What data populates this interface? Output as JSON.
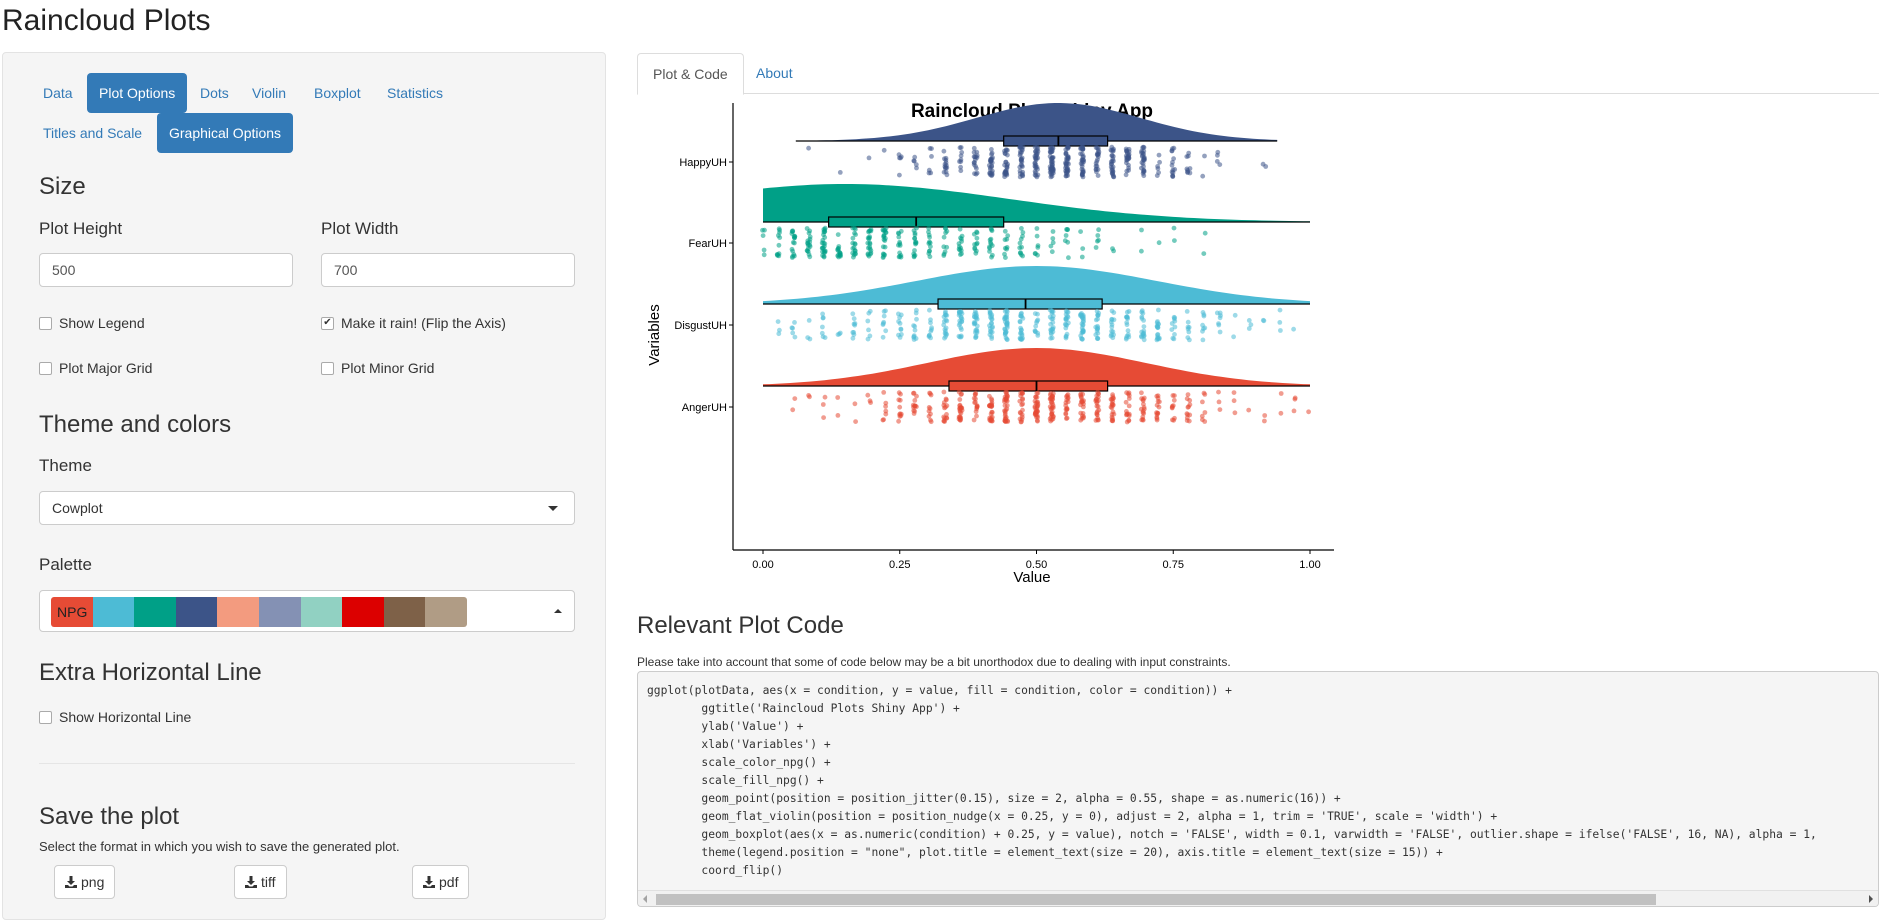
{
  "app": {
    "title": "Raincloud Plots"
  },
  "sidebar": {
    "pills_row1": [
      {
        "label": "Data",
        "active": false
      },
      {
        "label": "Plot Options",
        "active": true
      },
      {
        "label": "Dots",
        "active": false
      },
      {
        "label": "Violin",
        "active": false
      },
      {
        "label": "Boxplot",
        "active": false
      },
      {
        "label": "Statistics",
        "active": false
      }
    ],
    "pills_row2": [
      {
        "label": "Titles and Scale",
        "active": false
      },
      {
        "label": "Graphical Options",
        "active": true
      }
    ],
    "size": {
      "heading": "Size",
      "plot_height_label": "Plot Height",
      "plot_height_value": "500",
      "plot_width_label": "Plot Width",
      "plot_width_value": "700"
    },
    "checkboxes": {
      "show_legend": {
        "label": "Show Legend",
        "checked": false
      },
      "make_it_rain": {
        "label": "Make it rain! (Flip the Axis)",
        "checked": true
      },
      "major_grid": {
        "label": "Plot Major Grid",
        "checked": false
      },
      "minor_grid": {
        "label": "Plot Minor Grid",
        "checked": false
      }
    },
    "theme_colors": {
      "heading": "Theme and colors",
      "theme_label": "Theme",
      "theme_value": "Cowplot",
      "palette_label": "Palette",
      "palette_name": "NPG",
      "palette_colors": [
        "#E64B35",
        "#4DBBD5",
        "#00A087",
        "#3C5488",
        "#F39B7F",
        "#8491B4",
        "#91D1C2",
        "#DC0000",
        "#7E6148",
        "#B09C85"
      ]
    },
    "extra_line": {
      "heading": "Extra Horizontal Line",
      "show_label": "Show Horizontal Line",
      "checked": false
    },
    "save": {
      "heading": "Save the plot",
      "help": "Select the format in which you wish to save the generated plot.",
      "buttons": [
        "png",
        "tiff",
        "pdf"
      ]
    }
  },
  "main": {
    "tabs": [
      {
        "label": "Plot & Code",
        "active": true
      },
      {
        "label": "About",
        "active": false
      }
    ],
    "code_heading": "Relevant Plot Code",
    "code_note": "Please take into account that some of code below may be a bit unorthodox due to dealing with input constraints.",
    "code_lines": [
      "ggplot(plotData, aes(x = condition, y = value, fill = condition, color = condition)) +",
      "        ggtitle('Raincloud Plots Shiny App') +",
      "        ylab('Value') +",
      "        xlab('Variables') +",
      "        scale_color_npg() +",
      "        scale_fill_npg() +",
      "        geom_point(position = position_jitter(0.15), size = 2, alpha = 0.55, shape = as.numeric(16)) +",
      "        geom_flat_violin(position = position_nudge(x = 0.25, y = 0), adjust = 2, alpha = 1, trim = 'TRUE', scale = 'width') +",
      "        geom_boxplot(aes(x = as.numeric(condition) + 0.25, y = value), notch = 'FALSE', width = 0.1, varwidth = 'FALSE', outlier.shape = ifelse('FALSE', 16, NA), alpha = 1,",
      "        theme(legend.position = \"none\", plot.title = element_text(size = 20), axis.title = element_text(size = 15)) +",
      "        coord_flip()"
    ]
  },
  "chart_data": {
    "type": "raincloud",
    "title": "Raincloud Plots Shiny App",
    "xlabel": "Value",
    "ylabel": "Variables",
    "xlim": [
      0,
      1
    ],
    "x_ticks": [
      "0.00",
      "0.25",
      "0.50",
      "0.75",
      "1.00"
    ],
    "grid": false,
    "legend": "none",
    "series": [
      {
        "name": "HappyUH",
        "color": "#3C5488",
        "min": 0.06,
        "q1": 0.44,
        "median": 0.54,
        "q3": 0.63,
        "max": 0.94,
        "density_mode": 0.54,
        "density_spread": 0.15
      },
      {
        "name": "FearUH",
        "color": "#00A087",
        "min": 0.0,
        "q1": 0.12,
        "median": 0.28,
        "q3": 0.44,
        "max": 1.0,
        "density_mode": 0.15,
        "density_spread": 0.3
      },
      {
        "name": "DisgustUH",
        "color": "#4DBBD5",
        "min": 0.0,
        "q1": 0.32,
        "median": 0.48,
        "q3": 0.62,
        "max": 1.0,
        "density_mode": 0.5,
        "density_spread": 0.22
      },
      {
        "name": "AngerUH",
        "color": "#E64B35",
        "min": 0.0,
        "q1": 0.34,
        "median": 0.5,
        "q3": 0.63,
        "max": 1.0,
        "density_mode": 0.5,
        "density_spread": 0.2
      }
    ]
  }
}
